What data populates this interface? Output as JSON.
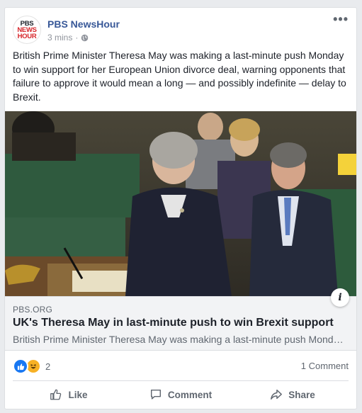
{
  "post": {
    "page_name": "PBS NewsHour",
    "timestamp": "3 mins",
    "text": "British Prime Minister Theresa May was making a last-minute push Monday to win support for her European Union divorce deal, warning opponents that failure to approve it would mean a long — and possibly indefinite — delay to Brexit."
  },
  "avatar": {
    "line1": "PBS",
    "line2": "NEWS",
    "line3": "HOUR"
  },
  "link": {
    "domain": "PBS.ORG",
    "title": "UK's Theresa May in last-minute push to win Brexit support",
    "description": "British Prime Minister Theresa May was making a last-minute push Monday to win support for her European Union divorce deal",
    "info_glyph": "i"
  },
  "engagement": {
    "reactions_count": "2",
    "comments": "1 Comment"
  },
  "actions": {
    "like": "Like",
    "comment": "Comment",
    "share": "Share"
  },
  "more_glyph": "•••",
  "colors": {
    "brand_blue": "#385898",
    "like_blue": "#1877f2",
    "text_gray": "#606770"
  }
}
